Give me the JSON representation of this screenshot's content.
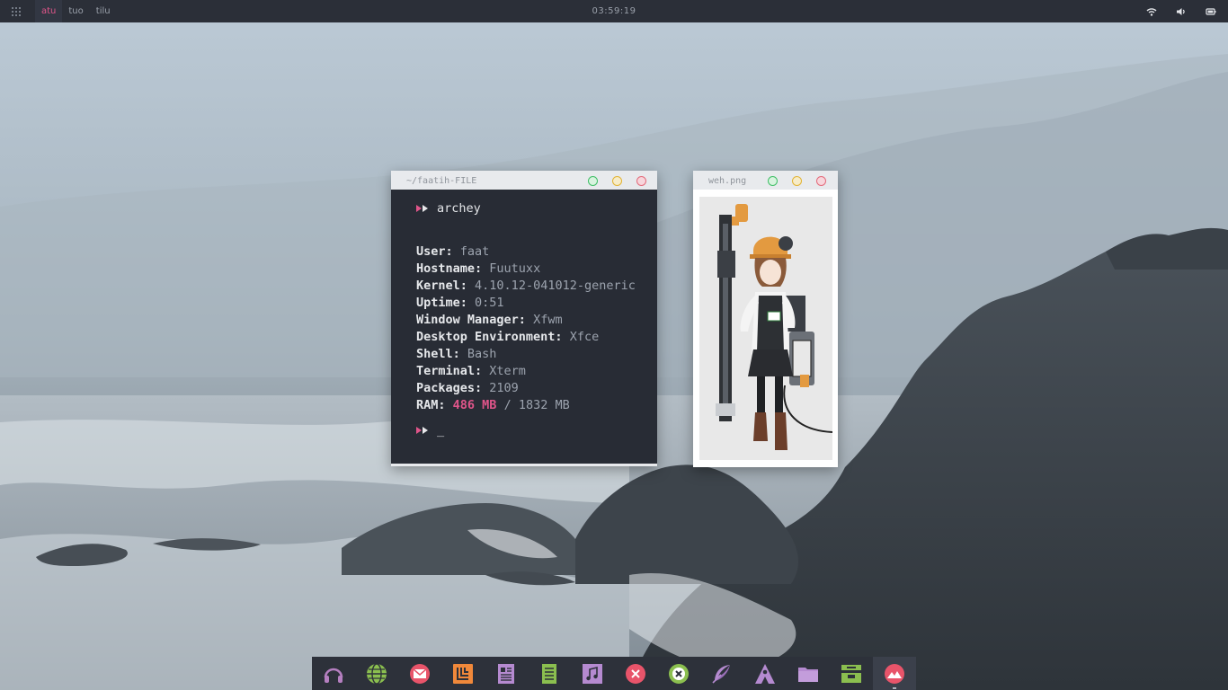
{
  "panel": {
    "workspaces": [
      {
        "label": "atu",
        "active": true
      },
      {
        "label": "tuo",
        "active": false
      },
      {
        "label": "tilu",
        "active": false
      }
    ],
    "clock": "03:59:19",
    "tray_icons": [
      "wifi-icon",
      "volume-icon",
      "battery-icon"
    ]
  },
  "terminal": {
    "title": "~/faatih-FILE",
    "command": "archey",
    "info": [
      {
        "key": "User:",
        "value": "faat"
      },
      {
        "key": "Hostname:",
        "value": "Fuutuxx"
      },
      {
        "key": "Kernel:",
        "value": "4.10.12-041012-generic"
      },
      {
        "key": "Uptime:",
        "value": "0:51"
      },
      {
        "key": "Window Manager:",
        "value": "Xfwm"
      },
      {
        "key": "Desktop Environment:",
        "value": "Xfce"
      },
      {
        "key": "Shell:",
        "value": "Bash"
      },
      {
        "key": "Terminal:",
        "value": "Xterm"
      },
      {
        "key": "Packages:",
        "value": "2109"
      }
    ],
    "ram": {
      "key": "RAM:",
      "used": "486 MB",
      "sep": " / ",
      "total": "1832 MB"
    },
    "cursor": "_"
  },
  "viewer": {
    "title": "weh.png"
  },
  "dock": {
    "items": [
      {
        "icon": "headphones-icon",
        "color": "#b57fc0"
      },
      {
        "icon": "globe-icon",
        "color": "#8bbf4f"
      },
      {
        "icon": "mail-icon",
        "color": "#e8546a"
      },
      {
        "icon": "office-icon",
        "color": "#f0883a"
      },
      {
        "icon": "document-icon",
        "color": "#b58ad0"
      },
      {
        "icon": "spreadsheet-icon",
        "color": "#8bbf4f"
      },
      {
        "icon": "music-icon",
        "color": "#b58ad0"
      },
      {
        "icon": "close-app-icon",
        "color": "#e8546a"
      },
      {
        "icon": "xfce-icon",
        "color": "#8bbf4f"
      },
      {
        "icon": "feather-icon",
        "color": "#b58ad0"
      },
      {
        "icon": "launcher-icon",
        "color": "#b58ad0"
      },
      {
        "icon": "folder-icon",
        "color": "#b58ad0"
      },
      {
        "icon": "archive-icon",
        "color": "#8bbf4f"
      },
      {
        "icon": "photos-icon",
        "color": "#e8546a"
      }
    ]
  }
}
